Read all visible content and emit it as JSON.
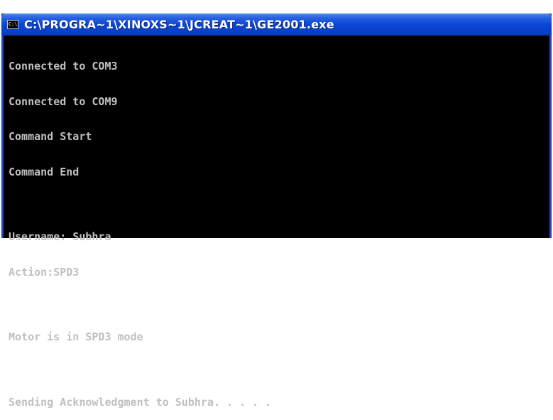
{
  "window": {
    "title": "C:\\PROGRA~1\\XINOXS~1\\JCREAT~1\\GE2001.exe",
    "icon": "console-icon",
    "icon_glyph": "C:\\"
  },
  "console": {
    "lines": [
      "Connected to COM3",
      "Connected to COM9",
      "Command Start",
      "Command End",
      "",
      "Username: Subhra",
      "Action:SPD3",
      "",
      "Motor is in SPD3 mode",
      "",
      "Sending Acknowledgment to Subhra. . . . ."
    ],
    "text_color": "#c0c0c0",
    "background_color": "#000000"
  },
  "colors": {
    "titlebar": "#0a46d6",
    "title_text": "#ffffff"
  }
}
